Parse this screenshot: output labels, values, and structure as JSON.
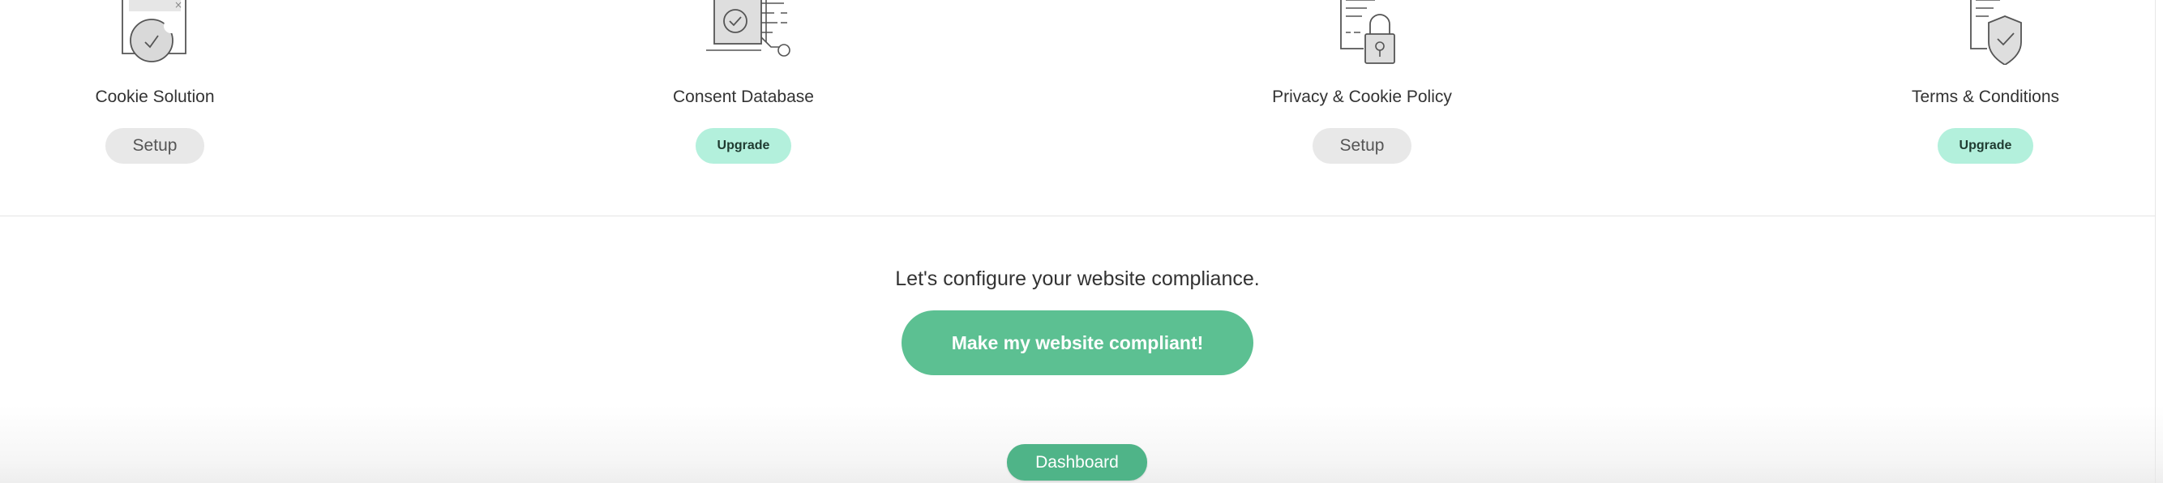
{
  "products": [
    {
      "title": "Cookie Solution",
      "action": "Setup",
      "icon": "cookie-solution-icon"
    },
    {
      "title": "Consent Database",
      "action": "Upgrade",
      "icon": "consent-database-icon"
    },
    {
      "title": "Privacy & Cookie Policy",
      "action": "Setup",
      "icon": "privacy-policy-lock-icon"
    },
    {
      "title": "Terms & Conditions",
      "action": "Upgrade",
      "icon": "terms-shield-icon"
    }
  ],
  "cta": {
    "text": "Let's configure your website compliance.",
    "button_label": "Make my website compliant!"
  },
  "footer": {
    "dashboard_label": "Dashboard"
  },
  "colors": {
    "primary_green": "#5cc092",
    "upgrade_bg": "#b3f0dc",
    "setup_bg": "#e8e8e8"
  }
}
